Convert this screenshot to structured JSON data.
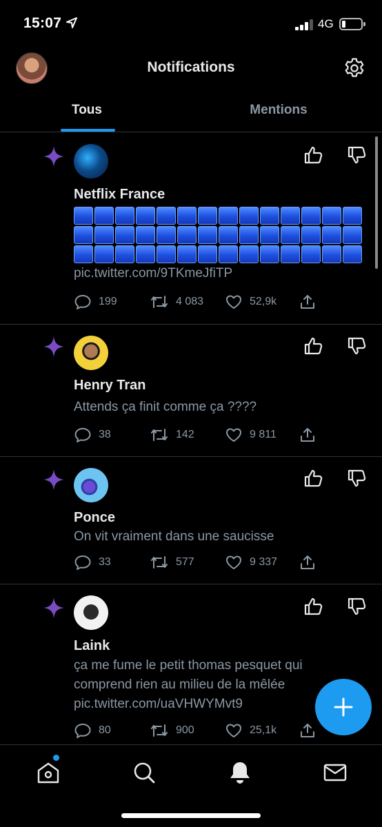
{
  "status_bar": {
    "time": "15:07",
    "network": "4G"
  },
  "header": {
    "title": "Notifications"
  },
  "tabs": [
    {
      "label": "Tous",
      "selected": true
    },
    {
      "label": "Mentions",
      "selected": false
    }
  ],
  "notifications": [
    {
      "name": "Netflix France",
      "emoji_grid": {
        "rows": 3,
        "cols": 14,
        "emoji": "blue-square"
      },
      "text": "pic.twitter.com/9TKmeJfiTP",
      "replies": "199",
      "retweets": "4 083",
      "likes": "52,9k"
    },
    {
      "name": "Henry Tran",
      "text": "Attends ça finit comme ça ????",
      "replies": "38",
      "retweets": "142",
      "likes": "9 811"
    },
    {
      "name": "Ponce",
      "text": "On vit vraiment dans une saucisse",
      "replies": "33",
      "retweets": "577",
      "likes": "9 337"
    },
    {
      "name": "Laink",
      "text_lines": [
        "ça me fume le petit thomas pesquet qui",
        "comprend rien au milieu de la mêlée",
        "pic.twitter.com/uaVHWYMvt9"
      ],
      "replies": "80",
      "retweets": "900",
      "likes": "25,1k"
    }
  ],
  "icons": {
    "notification_type": "sparkle-icon",
    "feedback_positive": "thumbs-up-icon",
    "feedback_negative": "thumbs-down-icon",
    "nav": [
      "home-icon",
      "search-icon",
      "bell-icon",
      "mail-icon"
    ]
  },
  "colors": {
    "accent": "#1d9bf0",
    "sparkle": "#794bc4",
    "background": "#000000",
    "secondary_text": "#8b98a5"
  }
}
